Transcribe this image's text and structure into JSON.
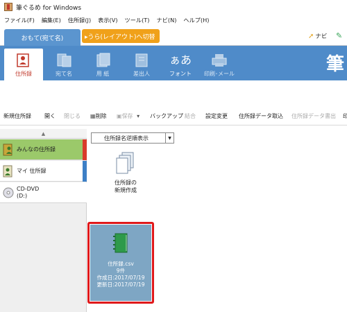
{
  "window": {
    "title": "筆ぐるめ for Windows"
  },
  "menu": [
    "ファイル(F)",
    "編集(E)",
    "住所録(J)",
    "表示(V)",
    "ツール(T)",
    "ナビ(N)",
    "ヘルプ(H)"
  ],
  "mode_tabs": {
    "front": "おもて(宛て名)",
    "back": "▸うら(レイアウト)へ切替"
  },
  "navi_label": "ナビ",
  "brand_char": "筆",
  "ribbon_tabs": [
    "住所録",
    "宛て名",
    "用 紙",
    "差出人",
    "フォント",
    "印刷･メール"
  ],
  "toolbar": {
    "new_address_book": "新規住所録",
    "open": "開く",
    "close": "閉じる",
    "delete": "削除",
    "save": "保存",
    "backup": "バックアップ",
    "merge": "結合",
    "change_settings": "設定変更",
    "import_data": "住所録データ取込",
    "export_data": "住所録データ書出",
    "more": "印"
  },
  "sidebar": {
    "scroll_up": "▲",
    "items": [
      {
        "label": "みんなの住所録",
        "stripe": "#d93b2b"
      },
      {
        "label": "マイ 住所録",
        "stripe": "#3d7fc6"
      },
      {
        "label_line1": "CD-DVD",
        "label_line2": "(D:)"
      }
    ]
  },
  "sort": {
    "label": "住所録名逆順表示",
    "arrow": "▼"
  },
  "new_card": {
    "line1": "住所録の",
    "line2": "新規作成"
  },
  "file_card": {
    "name": "住所録.csv",
    "count": "9件",
    "created": "作成日:2017/07/19",
    "updated": "更新日:2017/07/19"
  },
  "colors": {
    "ribbon": "#4f8bc9",
    "front_tab": "#5b95cf",
    "back_tab": "#f0a11a",
    "selected_item": "#9bc96a",
    "highlight_border": "#e0191b",
    "file_card_bg": "#7ea6c4"
  }
}
